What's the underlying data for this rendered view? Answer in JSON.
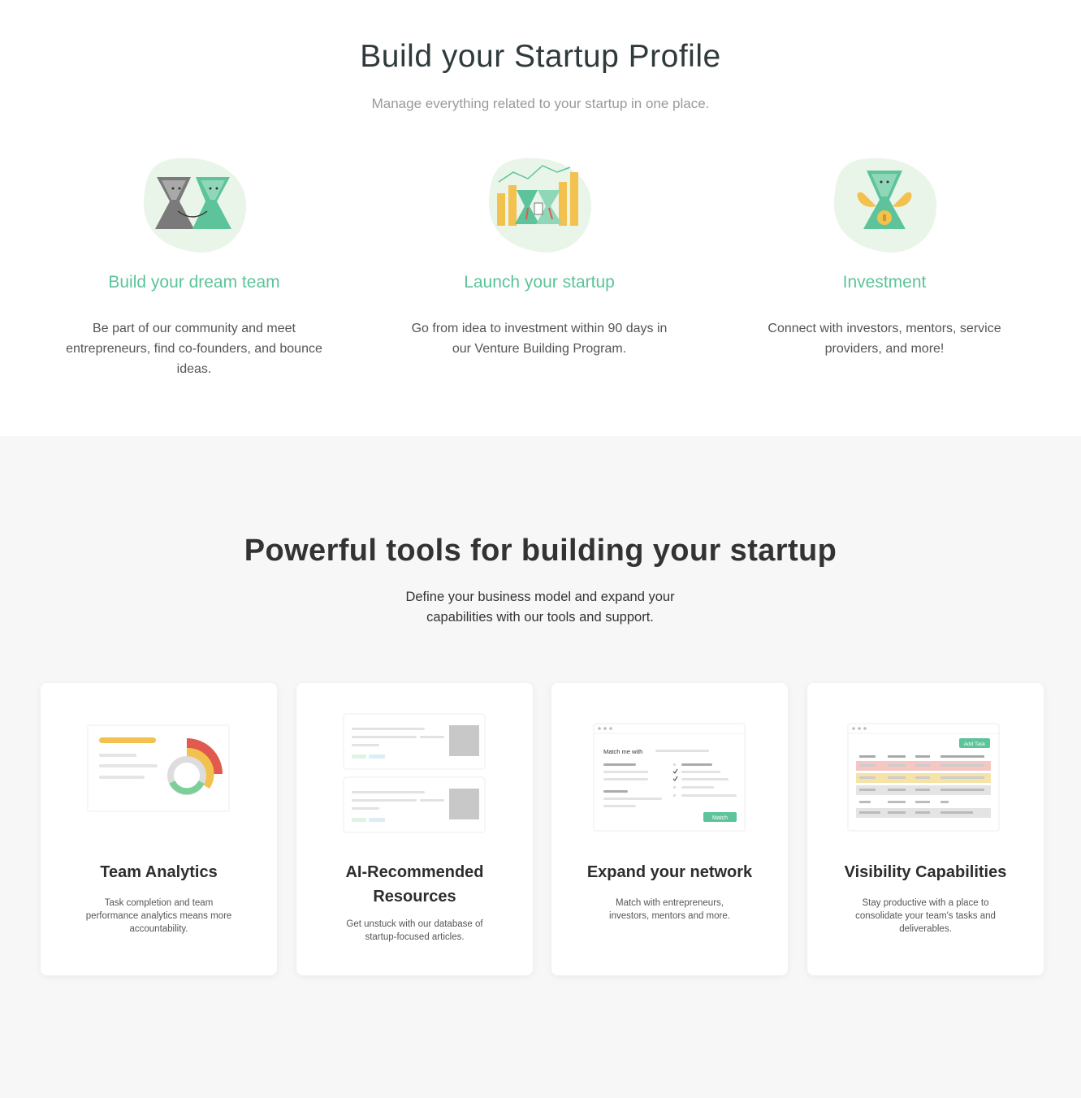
{
  "profile": {
    "title": "Build your Startup Profile",
    "subtitle": "Manage everything related to your startup in one place.",
    "features": [
      {
        "icon": "team-handshake-icon",
        "heading": "Build your dream team",
        "text": "Be part of our community and meet entrepreneurs, find co-founders, and bounce ideas."
      },
      {
        "icon": "launch-chart-icon",
        "heading": "Launch your startup",
        "text": "Go from idea to investment within 90 days in our Venture Building Program."
      },
      {
        "icon": "investment-wings-icon",
        "heading": "Investment",
        "text": "Connect with investors, mentors, service providers, and more!"
      }
    ]
  },
  "tools": {
    "title": "Powerful tools for building your startup",
    "subtitle": "Define your business model and expand your capabilities with our tools and support.",
    "cards": [
      {
        "heading": "Team Analytics",
        "text": "Task completion and team performance analytics means more accountability."
      },
      {
        "heading": "AI-Recommended Resources",
        "text": "Get unstuck with our database of startup-focused articles."
      },
      {
        "heading": "Expand your network",
        "text": "Match with entrepreneurs, investors, mentors and more.",
        "mock_label": "Match me with",
        "mock_button": "Match"
      },
      {
        "heading": "Visibility Capabilities",
        "text": "Stay productive with a place to consolidate your team's tasks and deliverables.",
        "mock_button": "Add Task"
      }
    ]
  },
  "colors": {
    "brand_green": "#5cc39a",
    "blob_green": "#eaf5ea",
    "yellow": "#f2c14e",
    "red": "#e05a4f",
    "gray": "#7a7a7a"
  }
}
